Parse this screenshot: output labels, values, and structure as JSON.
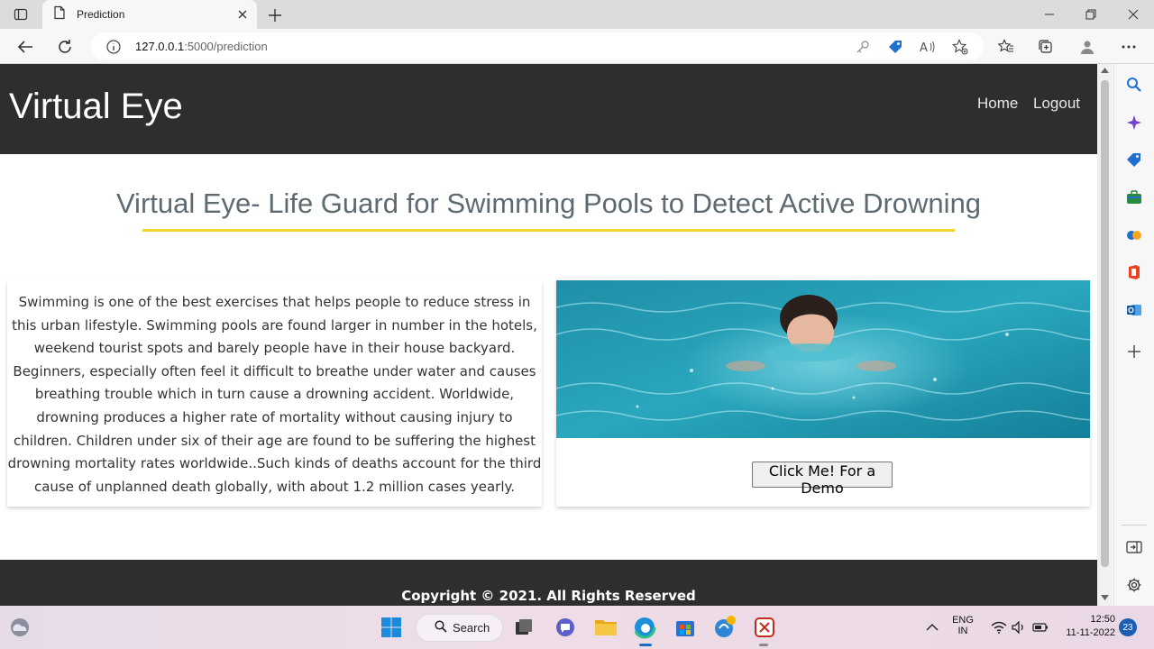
{
  "browser": {
    "tab_title": "Prediction",
    "url_host": "127.0.0.1",
    "url_path": ":5000/prediction"
  },
  "site": {
    "brand": "Virtual Eye",
    "nav": {
      "home": "Home",
      "logout": "Logout"
    },
    "headline": "Virtual Eye- Life Guard for Swimming Pools to Detect Active Drowning",
    "description": "Swimming is one of the best exercises that helps people to reduce stress in this urban lifestyle. Swimming pools are found larger in number in the hotels, weekend tourist spots and barely people have in their house backyard. Beginners, especially often feel it difficult to breathe under water and causes breathing trouble which in turn cause a drowning accident. Worldwide, drowning produces a higher rate of mortality without causing injury to children. Children under six of their age are found to be suffering the highest drowning mortality rates worldwide..Such kinds of deaths account for the third cause of unplanned death globally, with about 1.2 million cases yearly.",
    "demo_button": "Click Me! For a Demo",
    "footer": "Copyright © 2021. All Rights Reserved",
    "accent_color": "#f2d22e",
    "navbar_color": "#2e2e2e"
  },
  "taskbar": {
    "search_label": "Search",
    "lang_top": "ENG",
    "lang_bottom": "IN",
    "time": "12:50",
    "date": "11-11-2022",
    "notification_count": "23"
  }
}
